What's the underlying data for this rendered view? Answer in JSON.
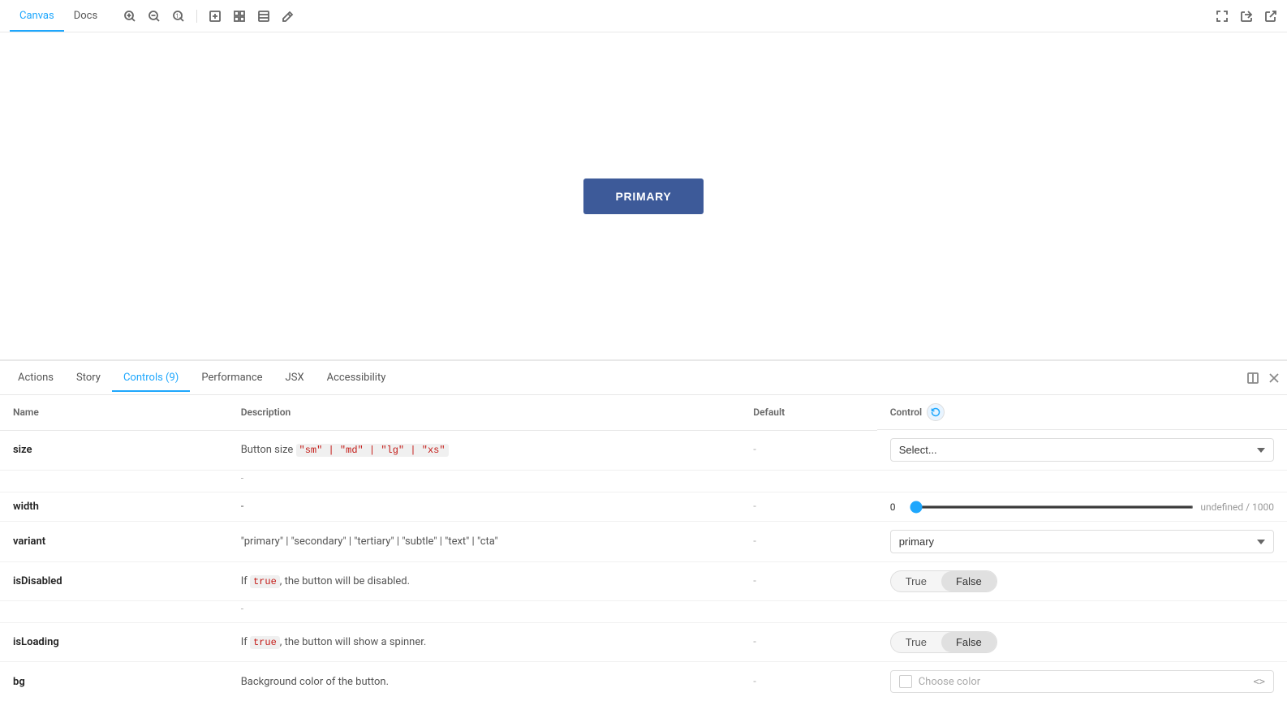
{
  "header": {
    "tabs": [
      {
        "label": "Canvas",
        "active": true
      },
      {
        "label": "Docs",
        "active": false
      }
    ],
    "right_icons": [
      "fullscreen-icon",
      "share-icon",
      "open-icon"
    ]
  },
  "canvas": {
    "preview_button_label": "PRIMARY"
  },
  "bottom_panel": {
    "tabs": [
      {
        "label": "Actions",
        "active": false
      },
      {
        "label": "Story",
        "active": false
      },
      {
        "label": "Controls (9)",
        "active": true
      },
      {
        "label": "Performance",
        "active": false
      },
      {
        "label": "JSX",
        "active": false
      },
      {
        "label": "Accessibility",
        "active": false
      }
    ],
    "table": {
      "headers": [
        "Name",
        "Description",
        "Default",
        "Control"
      ],
      "rows": [
        {
          "name": "size",
          "description_text": "Button size ",
          "description_code": "\"sm\" | \"md\" | \"lg\" | \"xs\"",
          "sub_dash": "-",
          "default": "-",
          "control_type": "select",
          "control_placeholder": "Select..."
        },
        {
          "name": "width",
          "description_text": "-",
          "default": "-",
          "control_type": "slider",
          "slider_min": "0",
          "slider_max": "undefined / 1000"
        },
        {
          "name": "variant",
          "description_text": "\"primary\" | \"secondary\" | \"tertiary\" | \"subtle\" | \"text\" | \"cta\"",
          "default": "-",
          "control_type": "select",
          "control_value": "primary"
        },
        {
          "name": "isDisabled",
          "description_prefix": "If ",
          "description_code": "true",
          "description_suffix": ", the button will be disabled.",
          "sub_dash": "-",
          "default": "-",
          "control_type": "toggle",
          "toggle_true_label": "True",
          "toggle_false_label": "False",
          "toggle_active": "False"
        },
        {
          "name": "isLoading",
          "description_prefix": "If ",
          "description_code": "true",
          "description_suffix": ", the button will show a spinner.",
          "default": "-",
          "control_type": "toggle",
          "toggle_true_label": "True",
          "toggle_false_label": "False",
          "toggle_active": "False"
        },
        {
          "name": "bg",
          "description_text": "Background color of the button.",
          "default": "-",
          "control_type": "color",
          "control_placeholder": "Choose color"
        }
      ]
    }
  }
}
